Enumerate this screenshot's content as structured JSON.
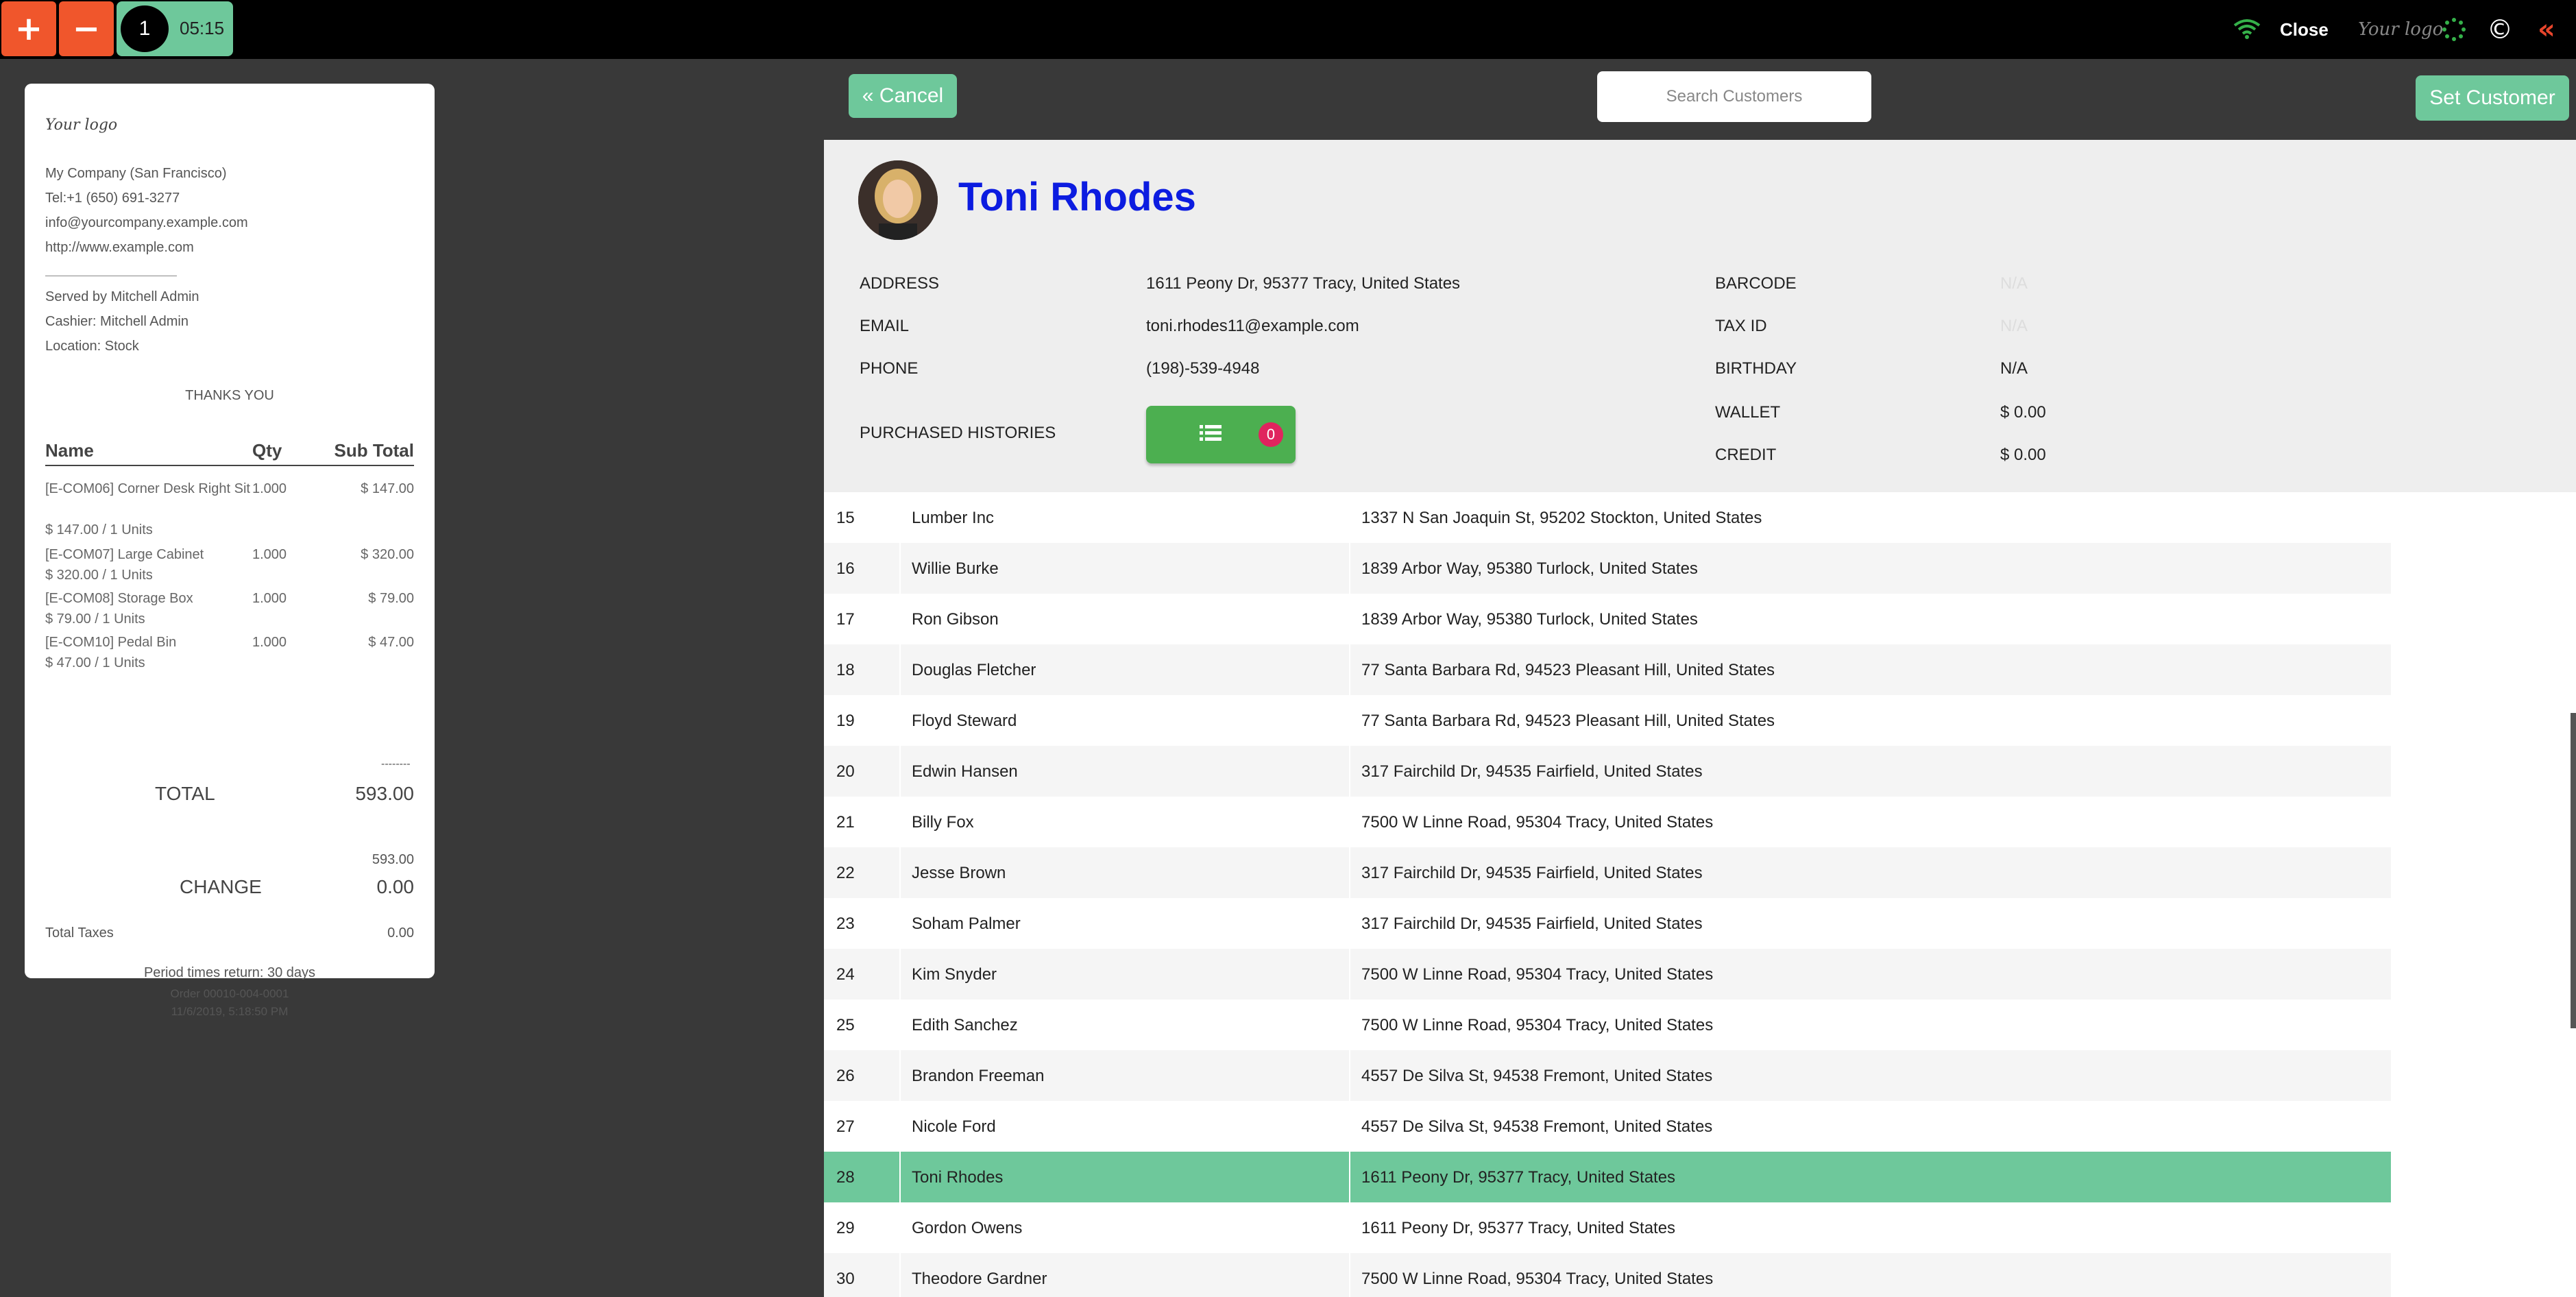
{
  "topbar": {
    "add_glyph": "+",
    "remove_glyph": "−",
    "order_number": "1",
    "order_time": "05:15",
    "close_label": "Close",
    "logo_text": "Your logo",
    "copyright_glyph": "©",
    "back_glyph": "«",
    "colors": {
      "accent_orange": "#f0562c",
      "accent_green": "#6ec89b"
    }
  },
  "receipt": {
    "logo_text": "Your logo",
    "company": "My Company (San Francisco)",
    "tel": "Tel:+1 (650) 691-3277",
    "email": "info@yourcompany.example.com",
    "website": "http://www.example.com",
    "separator": "------------------------------------------",
    "served_by": "Served by Mitchell Admin",
    "cashier": "Cashier: Mitchell Admin",
    "location": "Location: Stock",
    "thanks": "THANKS YOU",
    "columns": {
      "name": "Name",
      "qty": "Qty",
      "subtotal": "Sub Total"
    },
    "lines": [
      {
        "name": "[E-COM06] Corner Desk Right Sit",
        "qty": "1.000",
        "subtotal": "$ 147.00",
        "unit": "$ 147.00 / 1 Units"
      },
      {
        "name": "[E-COM07] Large Cabinet",
        "qty": "1.000",
        "subtotal": "$ 320.00",
        "unit": "$ 320.00 / 1 Units"
      },
      {
        "name": "[E-COM08] Storage Box",
        "qty": "1.000",
        "subtotal": "$ 79.00",
        "unit": "$ 79.00 / 1 Units"
      },
      {
        "name": "[E-COM10] Pedal Bin",
        "qty": "1.000",
        "subtotal": "$ 47.00",
        "unit": "$ 47.00 / 1 Units"
      }
    ],
    "dash": "--------",
    "total_label": "TOTAL",
    "total_value": "593.00",
    "paid_value": "593.00",
    "change_label": "CHANGE",
    "change_value": "0.00",
    "taxes_label": "Total Taxes",
    "taxes_value": "0.00",
    "return_period": "Period times return: 30 days",
    "order_ref": "Order 00010-004-0001",
    "order_date": "11/6/2019, 5:18:50 PM"
  },
  "actions": {
    "cancel_label": "« Cancel",
    "search_placeholder": "Search Customers",
    "set_customer_label": "Set Customer"
  },
  "customer": {
    "name": "Toni Rhodes",
    "address_label": "ADDRESS",
    "address": "1611 Peony Dr, 95377 Tracy, United States",
    "email_label": "EMAIL",
    "email": "toni.rhodes11@example.com",
    "phone_label": "PHONE",
    "phone": "(198)-539-4948",
    "history_label": "PURCHASED HISTORIES",
    "history_count": "0",
    "barcode_label": "BARCODE",
    "barcode": "N/A",
    "taxid_label": "TAX ID",
    "taxid": "N/A",
    "birthday_label": "BIRTHDAY",
    "birthday": "N/A",
    "wallet_label": "WALLET",
    "wallet": "$ 0.00",
    "credit_label": "CREDIT",
    "credit": "$ 0.00",
    "name_color": "#0c1ce0"
  },
  "customers": [
    {
      "id": "15",
      "name": "Lumber Inc",
      "address": "1337 N San Joaquin St, 95202 Stockton, United States"
    },
    {
      "id": "16",
      "name": "Willie Burke",
      "address": "1839 Arbor Way, 95380 Turlock, United States"
    },
    {
      "id": "17",
      "name": "Ron Gibson",
      "address": "1839 Arbor Way, 95380 Turlock, United States"
    },
    {
      "id": "18",
      "name": "Douglas Fletcher",
      "address": "77 Santa Barbara Rd, 94523 Pleasant Hill, United States"
    },
    {
      "id": "19",
      "name": "Floyd Steward",
      "address": "77 Santa Barbara Rd, 94523 Pleasant Hill, United States"
    },
    {
      "id": "20",
      "name": "Edwin Hansen",
      "address": "317 Fairchild Dr, 94535 Fairfield, United States"
    },
    {
      "id": "21",
      "name": "Billy Fox",
      "address": "7500 W Linne Road, 95304 Tracy, United States"
    },
    {
      "id": "22",
      "name": "Jesse Brown",
      "address": "317 Fairchild Dr, 94535 Fairfield, United States"
    },
    {
      "id": "23",
      "name": "Soham Palmer",
      "address": "317 Fairchild Dr, 94535 Fairfield, United States"
    },
    {
      "id": "24",
      "name": "Kim Snyder",
      "address": "7500 W Linne Road, 95304 Tracy, United States"
    },
    {
      "id": "25",
      "name": "Edith Sanchez",
      "address": "7500 W Linne Road, 95304 Tracy, United States"
    },
    {
      "id": "26",
      "name": "Brandon Freeman",
      "address": "4557 De Silva St, 94538 Fremont, United States"
    },
    {
      "id": "27",
      "name": "Nicole Ford",
      "address": "4557 De Silva St, 94538 Fremont, United States"
    },
    {
      "id": "28",
      "name": "Toni Rhodes",
      "address": "1611 Peony Dr, 95377 Tracy, United States",
      "selected": true
    },
    {
      "id": "29",
      "name": "Gordon Owens",
      "address": "1611 Peony Dr, 95377 Tracy, United States"
    },
    {
      "id": "30",
      "name": "Theodore Gardner",
      "address": "7500 W Linne Road, 95304 Tracy, United States"
    }
  ]
}
